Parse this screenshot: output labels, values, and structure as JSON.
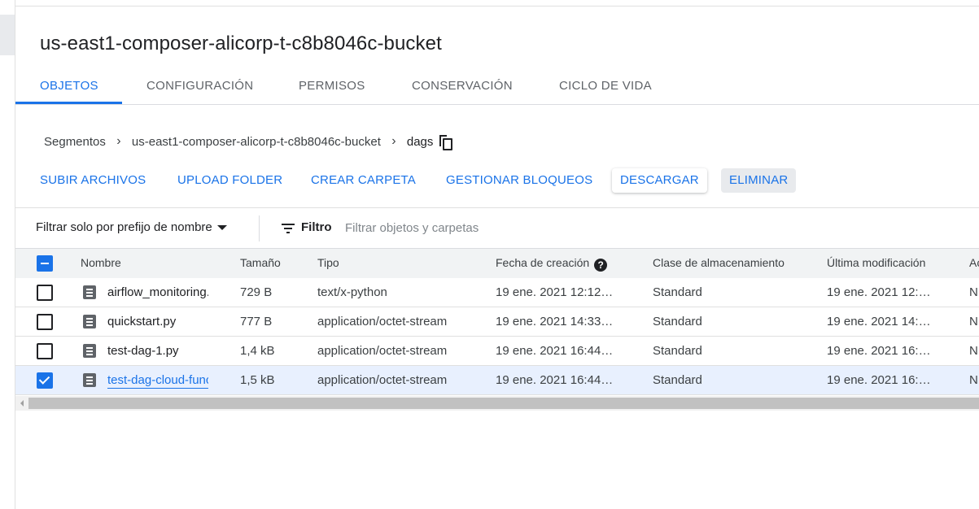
{
  "bucket": {
    "title": "us-east1-composer-alicorp-t-c8b8046c-bucket"
  },
  "tabs": [
    {
      "label": "OBJETOS"
    },
    {
      "label": "CONFIGURACIÓN"
    },
    {
      "label": "PERMISOS"
    },
    {
      "label": "CONSERVACIÓN"
    },
    {
      "label": "CICLO DE VIDA"
    }
  ],
  "breadcrumb": {
    "items": [
      "Segmentos",
      "us-east1-composer-alicorp-t-c8b8046c-bucket",
      "dags"
    ],
    "separator": "›"
  },
  "actions": {
    "upload_files": "SUBIR ARCHIVOS",
    "upload_folder": "UPLOAD FOLDER",
    "create_folder": "CREAR CARPETA",
    "manage_holds": "GESTIONAR BLOQUEOS",
    "download": "DESCARGAR",
    "delete": "ELIMINAR"
  },
  "filter": {
    "mode_label": "Filtrar solo por prefijo de nombre",
    "label": "Filtro",
    "placeholder": "Filtrar objetos y carpetas"
  },
  "table": {
    "columns": {
      "name": "Nombre",
      "size": "Tamaño",
      "type": "Tipo",
      "created": "Fecha de creación",
      "storage_class": "Clase de almacenamiento",
      "modified": "Última modificación",
      "extra": "Ac"
    },
    "help_glyph": "?",
    "rows": [
      {
        "name": "airflow_monitoring.py",
        "size": "729 B",
        "type": "text/x-python",
        "created": "19 ene. 2021 12:12…",
        "storage_class": "Standard",
        "modified": "19 ene. 2021 12:…",
        "extra": "N",
        "checked": false
      },
      {
        "name": "quickstart.py",
        "size": "777 B",
        "type": "application/octet-stream",
        "created": "19 ene. 2021 14:33…",
        "storage_class": "Standard",
        "modified": "19 ene. 2021 14:…",
        "extra": "N",
        "checked": false
      },
      {
        "name": "test-dag-1.py",
        "size": "1,4 kB",
        "type": "application/octet-stream",
        "created": "19 ene. 2021 16:44…",
        "storage_class": "Standard",
        "modified": "19 ene. 2021 16:…",
        "extra": "N",
        "checked": false
      },
      {
        "name": "test-dag-cloud-function.py",
        "size": "1,5 kB",
        "type": "application/octet-stream",
        "created": "19 ene. 2021 16:44…",
        "storage_class": "Standard",
        "modified": "19 ene. 2021 16:…",
        "extra": "N",
        "checked": true
      }
    ]
  },
  "colors": {
    "accent": "#1a73e8",
    "selected_row": "#e8f0fe",
    "header_bg": "#f1f3f4"
  }
}
